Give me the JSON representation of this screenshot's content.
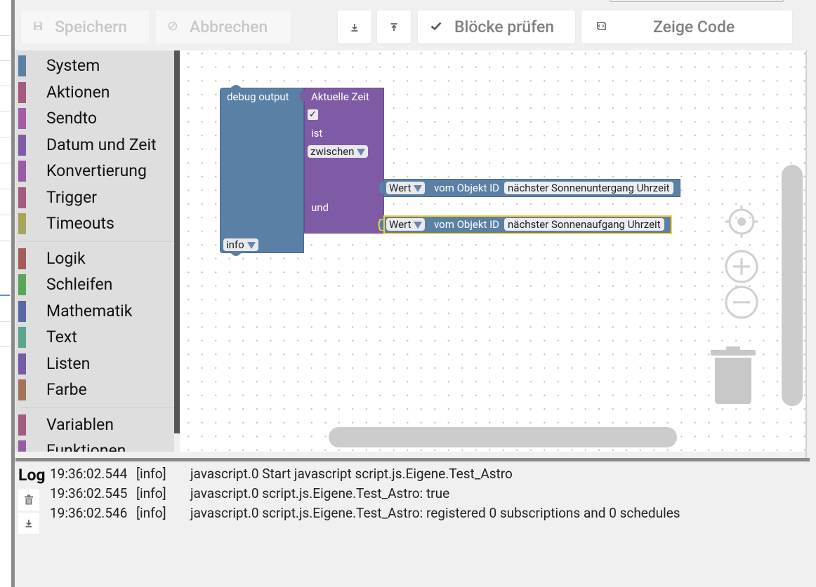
{
  "toolbar": {
    "save_label": "Speichern",
    "cancel_label": "Abbrechen",
    "check_label": "Blöcke prüfen",
    "code_label": "Zeige Code"
  },
  "toolbox": {
    "categories": [
      {
        "label": "System",
        "color": "#5b80a5"
      },
      {
        "label": "Aktionen",
        "color": "#a55b80"
      },
      {
        "label": "Sendto",
        "color": "#a55ba5"
      },
      {
        "label": "Datum und Zeit",
        "color": "#805ba5"
      },
      {
        "label": "Konvertierung",
        "color": "#995ba5"
      },
      {
        "label": "Trigger",
        "color": "#a55b80"
      },
      {
        "label": "Timeouts",
        "color": "#a5a55b"
      },
      {
        "label": "Logik",
        "color": "#a55b5b"
      },
      {
        "label": "Schleifen",
        "color": "#5ba55b"
      },
      {
        "label": "Mathematik",
        "color": "#5b67a5"
      },
      {
        "label": "Text",
        "color": "#5ba58c"
      },
      {
        "label": "Listen",
        "color": "#745ba5"
      },
      {
        "label": "Farbe",
        "color": "#a5745b"
      },
      {
        "label": "Variablen",
        "color": "#a55b80"
      },
      {
        "label": "Funktionen",
        "color": "#995ba5"
      }
    ]
  },
  "blocks": {
    "debug": {
      "label": "debug output",
      "level": "info",
      "color": "#5b80a5"
    },
    "time": {
      "label": "Aktuelle Zeit",
      "check": "✓",
      "is_label": "ist",
      "mode": "zwischen",
      "and_label": "und",
      "color": "#805ba5"
    },
    "sunset": {
      "value_label": "Wert",
      "object_label": "vom Objekt ID",
      "object": "nächster Sonnenuntergang Uhrzeit"
    },
    "sunrise": {
      "value_label": "Wert",
      "object_label": "vom Objekt ID",
      "object": "nächster Sonnenaufgang Uhrzeit"
    }
  },
  "log": {
    "title": "Log",
    "entries": [
      {
        "time": "19:36:02.544",
        "level": "[info]",
        "message": "javascript.0 Start javascript script.js.Eigene.Test_Astro"
      },
      {
        "time": "19:36:02.545",
        "level": "[info]",
        "message": "javascript.0 script.js.Eigene.Test_Astro: true"
      },
      {
        "time": "19:36:02.546",
        "level": "[info]",
        "message": "javascript.0 script.js.Eigene.Test_Astro: registered 0 subscriptions and 0 schedules"
      }
    ]
  }
}
